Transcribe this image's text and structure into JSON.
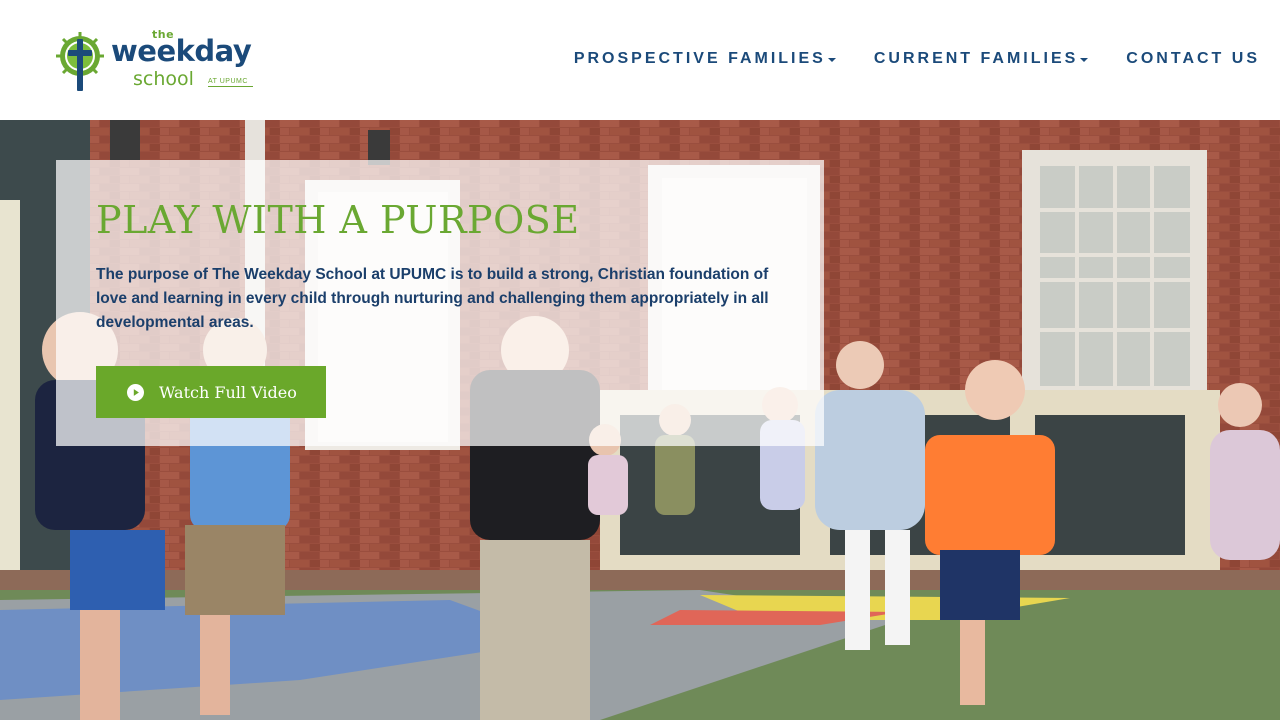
{
  "logo": {
    "the": "the",
    "weekday": "weekday",
    "school": "school",
    "at": "AT UPUMC",
    "colors": {
      "blue": "#1b4a7a",
      "green": "#6aa832"
    }
  },
  "nav": {
    "items": [
      {
        "label": "PROSPECTIVE FAMILIES",
        "has_dropdown": true
      },
      {
        "label": "CURRENT FAMILIES",
        "has_dropdown": true
      },
      {
        "label": "CONTACT US",
        "has_dropdown": false
      }
    ]
  },
  "hero": {
    "title": "PLAY WITH A PURPOSE",
    "text": "The purpose of The Weekday School at UPUMC is to build a strong, Christian foundation of love and learning in every child through nurturing and challenging them appropriately in all developmental areas.",
    "button_label": "Watch Full Video",
    "button_icon": "play-circle-icon",
    "colors": {
      "title": "#6aa832",
      "text": "#1b3f6b",
      "button": "#6aa82a"
    }
  }
}
